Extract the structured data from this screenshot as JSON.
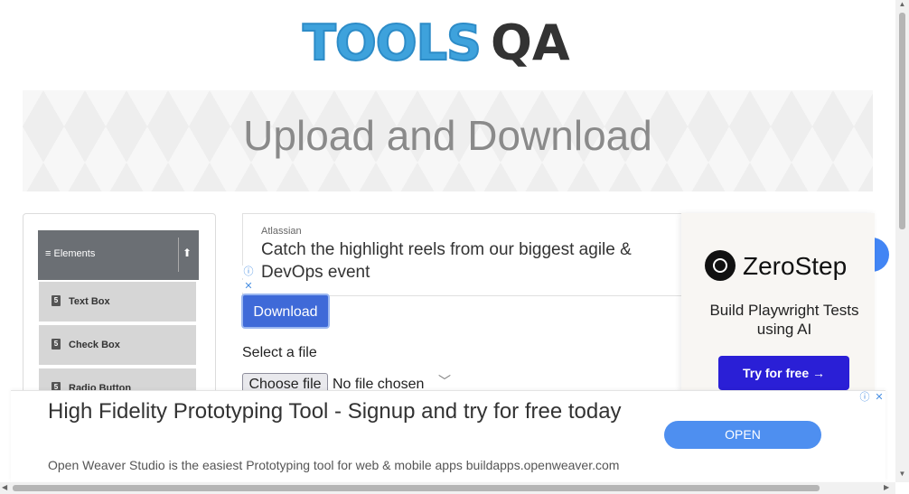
{
  "logo": {
    "text": "TOOLS",
    "qa": "QA"
  },
  "page": {
    "title": "Upload and Download"
  },
  "sidebar": {
    "header": "Elements",
    "items": [
      {
        "label": "Text Box"
      },
      {
        "label": "Check Box"
      },
      {
        "label": "Radio Button"
      }
    ]
  },
  "ad_top": {
    "sponsor": "Atlassian",
    "headline": "Catch the highlight reels from our biggest agile & DevOps event"
  },
  "main": {
    "download_label": "Download",
    "select_label": "Select a file",
    "choose_file_label": "Choose file",
    "no_file_text": "No file chosen"
  },
  "right_ad": {
    "brand": "ZeroStep",
    "tagline": "Build Playwright Tests using AI",
    "cta": "Try for free →"
  },
  "bottom_ad": {
    "headline": "High Fidelity Prototyping Tool - Signup and try for free today",
    "description": "Open Weaver Studio is the easiest Prototyping tool for web & mobile apps buildapps.openweaver.com",
    "cta": "OPEN"
  },
  "icons": {
    "info": "ⓘ",
    "close": "✕",
    "menu": "≡",
    "collapse": "⬆",
    "chevron": "﹀"
  },
  "colors": {
    "logo_blue": "#3ea2dc",
    "download_blue": "#3f6ad8",
    "zerostep_cta": "#2a1fd6",
    "open_button": "#4e8ff0"
  }
}
